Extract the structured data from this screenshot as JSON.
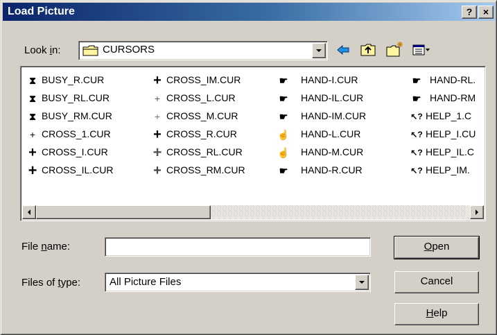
{
  "window": {
    "title": "Load Picture",
    "help_button": "?",
    "close_button": "×"
  },
  "lookin": {
    "label_prefix": "Look ",
    "label_mnemonic": "i",
    "label_suffix": "n:",
    "value": "CURSORS",
    "folder_icon": "folder-icon"
  },
  "toolbar": {
    "back_icon": "back-arrow-icon",
    "up_icon": "up-one-level-icon",
    "new_folder_icon": "new-folder-icon",
    "view_menu_icon": "view-menu-icon"
  },
  "files": {
    "columns": [
      [
        {
          "name": "BUSY_R.CUR",
          "icon": "hourglass-icon"
        },
        {
          "name": "BUSY_RL.CUR",
          "icon": "hourglass-icon"
        },
        {
          "name": "BUSY_RM.CUR",
          "icon": "hourglass-icon"
        },
        {
          "name": "CROSS_1.CUR",
          "icon": "crosshair-icon"
        },
        {
          "name": "CROSS_I.CUR",
          "icon": "crosshair-icon"
        },
        {
          "name": "CROSS_IL.CUR",
          "icon": "crosshair-icon"
        }
      ],
      [
        {
          "name": "CROSS_IM.CUR",
          "icon": "crosshair-icon"
        },
        {
          "name": "CROSS_L.CUR",
          "icon": "crosshair-icon"
        },
        {
          "name": "CROSS_M.CUR",
          "icon": "crosshair-icon"
        },
        {
          "name": "CROSS_R.CUR",
          "icon": "crosshair-icon"
        },
        {
          "name": "CROSS_RL.CUR",
          "icon": "crosshair-icon"
        },
        {
          "name": "CROSS_RM.CUR",
          "icon": "crosshair-icon"
        }
      ],
      [
        {
          "name": "HAND-I.CUR",
          "icon": "hand-cursor-icon"
        },
        {
          "name": "HAND-IL.CUR",
          "icon": "hand-cursor-icon"
        },
        {
          "name": "HAND-IM.CUR",
          "icon": "hand-cursor-icon"
        },
        {
          "name": "HAND-L.CUR",
          "icon": "hand-cursor-icon"
        },
        {
          "name": "HAND-M.CUR",
          "icon": "hand-cursor-icon"
        },
        {
          "name": "HAND-R.CUR",
          "icon": "hand-cursor-icon"
        }
      ],
      [
        {
          "name": "HAND-RL.",
          "icon": "hand-cursor-icon"
        },
        {
          "name": "HAND-RM",
          "icon": "hand-cursor-icon"
        },
        {
          "name": "HELP_1.C",
          "icon": "help-cursor-icon"
        },
        {
          "name": "HELP_I.CU",
          "icon": "help-cursor-icon"
        },
        {
          "name": "HELP_IL.C",
          "icon": "help-cursor-icon"
        },
        {
          "name": "HELP_IM.",
          "icon": "help-cursor-icon"
        }
      ]
    ]
  },
  "filename": {
    "label_prefix": "File ",
    "label_mnemonic": "n",
    "label_suffix": "ame:",
    "value": ""
  },
  "filetype": {
    "label_prefix": "Files of ",
    "label_mnemonic": "t",
    "label_suffix": "ype:",
    "value": "All Picture Files"
  },
  "buttons": {
    "open_mnemonic": "O",
    "open_rest": "pen",
    "cancel": "Cancel",
    "help_mnemonic": "H",
    "help_rest": "elp"
  }
}
